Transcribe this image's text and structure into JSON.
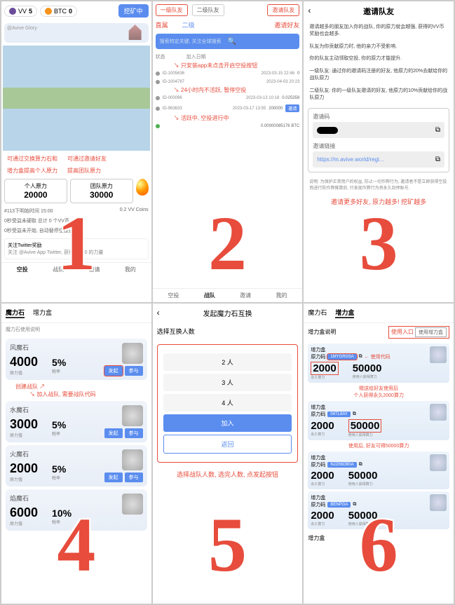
{
  "panel1": {
    "coin1_symbol": "VV",
    "coin1_value": "5",
    "coin2_symbol": "BTC",
    "coin2_value": "0",
    "top_btn": "挖矿中",
    "search_placeholder": "@Avive Glory",
    "red1": "可通过交换算力石和",
    "red2": "可通过邀请好友",
    "red3": "增力盒提高个人原力",
    "red4": "提高团队原力",
    "box1_label": "个人原力",
    "box1_value": "20000",
    "box2_label": "团队原力",
    "box2_value": "30000",
    "time_label": "#113下明始时间 15:00",
    "coins_label": "0.2 VV Coins",
    "info1": "0秒受益未硬取 总计 0 个VV币",
    "info2": "0秒受益未开始, 自动替停空投提取",
    "twitter_title": "关注Twitter奖励",
    "twitter_desc": "关注 @Avive App Twitter, 获得10000 的力量",
    "tabs": [
      "空投",
      "战队",
      "邀请",
      "我的"
    ]
  },
  "panel2": {
    "tabs": [
      "一级队友",
      "二级队友"
    ],
    "invite_btn": "邀请队友",
    "row2": [
      "直属",
      "二级"
    ],
    "row2_right": "邀请好友",
    "search_ph": "搜索特定关键, 关注全球搜索",
    "hdr": [
      "状态",
      "加入日期"
    ],
    "anno1": "只安装app未点击开启空投按钮",
    "anno2": "24小时内不活跃, 暂停空投",
    "anno3": "活跃中, 空投进行中",
    "rows": [
      {
        "id": "ID-1005636",
        "date": "2023-03-15 22:46",
        "num": "0"
      },
      {
        "id": "ID-1004787",
        "date": "2023-04-03 20:23",
        "num": ""
      },
      {
        "id": "ID-000096",
        "date": "2023-03-13 10:18",
        "num": "0.025359"
      },
      {
        "id": "ID-963633",
        "date": "2023-03-17 13:55",
        "num": "200000",
        "btn": "邀请"
      },
      {
        "id": "",
        "date": "",
        "num": "0.00000085176 BTC"
      }
    ],
    "bottom_tabs": [
      "空投",
      "战队",
      "邀请",
      "我的"
    ]
  },
  "panel3": {
    "title": "邀请队友",
    "p1": "邀请越多的朋友加入你的战队, 你的原力就会越强, 获得的VV币奖励也会越多.",
    "p2": "队友为你贡献原力时, 他的亲力不受影响.",
    "p3": "你的队友主动领取空投, 你的原力才能提升.",
    "p4": "一级队友: 通过你的邀请码注册的好友, 他原力的20%去献给你的战队原力",
    "p5": "二级队友: 你的一级队友邀请的好友, 他原力的10%贡献给你的战队原力",
    "code_label": "邀请码",
    "link_label": "邀请链接",
    "link": "https://m.avive.world/regi...",
    "footer": "说明: 为保护正常用户的权益, 防止一切作弊行为, 邀请者不是立即获得空投而进行防作弊推算后, 只发现作弊行为将永久封停账号.",
    "red": "邀请更多好友, 原力越多! 挖矿越多"
  },
  "panel4": {
    "tabs": [
      "魔力石",
      "增力盒"
    ],
    "sub": "魔力石使用说明",
    "anno1": "创建战队",
    "anno2": "加入战队, 需要战队代码",
    "stones": [
      {
        "name": "风魔石",
        "val": "4000",
        "lbl": "原力值",
        "pct": "5%",
        "plbl": "税率"
      },
      {
        "name": "水魔石",
        "val": "3000",
        "lbl": "原力值",
        "pct": "5%",
        "plbl": "税率"
      },
      {
        "name": "火魔石",
        "val": "2000",
        "lbl": "原力值",
        "pct": "5%",
        "plbl": "税率"
      },
      {
        "name": "焰魔石",
        "val": "6000",
        "lbl": "原力值",
        "pct": "10%",
        "plbl": "税率"
      }
    ],
    "btn1": "发起",
    "btn2": "参与"
  },
  "panel5": {
    "title": "发起魔力石互换",
    "sub": "选择互换人数",
    "opts": [
      "2 人",
      "3 人",
      "4 人"
    ],
    "join": "加入",
    "cancel": "返回",
    "red": "选择战队人数, 选完人数, 点发起按钮"
  },
  "panel6": {
    "tabs": [
      "魔力石",
      "增力盒"
    ],
    "sub": "增力盒说明",
    "entry": "使用入口",
    "use_btn": "使用增力盒",
    "anno1": "使用代码",
    "anno2a": "赠送给好友使用后",
    "anno2b": "个人获得永久2000算力",
    "anno3": "使用后, 好友可得50000算力",
    "cards": [
      {
        "code": "1MYGRG5A",
        "v1": "2000",
        "l1": "永久算力",
        "v2": "50000",
        "l2": "使用人获得算力",
        "hl": "v1"
      },
      {
        "code": "04TL9AY",
        "v1": "2000",
        "l1": "永久算力",
        "v2": "50000",
        "l2": "使用人获得算力",
        "hl": "v2"
      },
      {
        "code": "NJ206OB0A",
        "v1": "2000",
        "l1": "永久算力",
        "v2": "50000",
        "l2": "使用人获得算力",
        "hl": ""
      },
      {
        "code": "BENPGA",
        "v1": "2000",
        "l1": "永久算力",
        "v2": "50000",
        "l2": "使用人获得算力",
        "hl": ""
      }
    ],
    "card_title": "增力盒",
    "code_label": "原力码",
    "more": "增力盒"
  }
}
